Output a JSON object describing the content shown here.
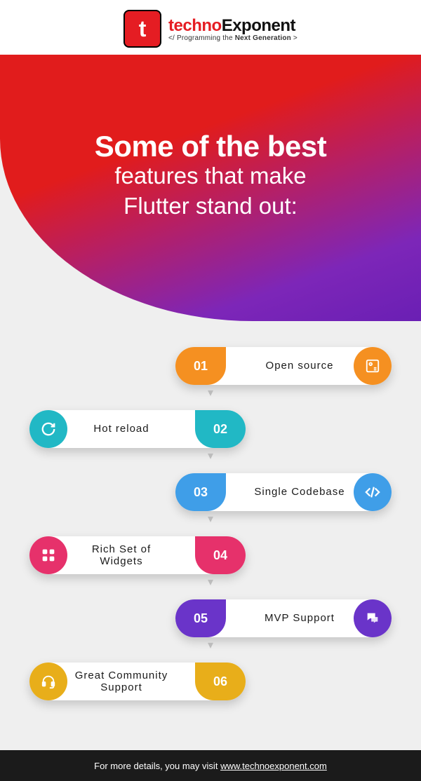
{
  "logo": {
    "glyph": "t",
    "brand_part1": "techno",
    "brand_part2": "Exponent",
    "tagline_prefix": "</ Programming the ",
    "tagline_strong": "Next Generation",
    "tagline_suffix": " >"
  },
  "hero": {
    "line1": "Some of the best",
    "line2": "features that make",
    "line3": "Flutter stand out:"
  },
  "items": [
    {
      "num": "01",
      "label": "Open  source",
      "side": "right",
      "color": "orange",
      "icon": "open-source-icon"
    },
    {
      "num": "02",
      "label": "Hot  reload",
      "side": "left",
      "color": "teal",
      "icon": "reload-icon"
    },
    {
      "num": "03",
      "label": "Single  Codebase",
      "side": "right",
      "color": "blue",
      "icon": "code-icon"
    },
    {
      "num": "04",
      "label": "Rich  Set  of\nWidgets",
      "side": "left",
      "color": "pink",
      "icon": "widgets-icon"
    },
    {
      "num": "05",
      "label": "MVP  Support",
      "side": "right",
      "color": "purple",
      "icon": "chat-icon"
    },
    {
      "num": "06",
      "label": "Great  Community\nSupport",
      "side": "left",
      "color": "gold",
      "icon": "headset-icon"
    }
  ],
  "footer": {
    "prefix": "For more details, you may visit ",
    "link_text": "www.technoexponent.com"
  },
  "colors": {
    "orange": "#f59021",
    "teal": "#21b8c5",
    "blue": "#3f9ee8",
    "pink": "#e6316b",
    "purple": "#6a34c9",
    "gold": "#e8ae1a"
  }
}
